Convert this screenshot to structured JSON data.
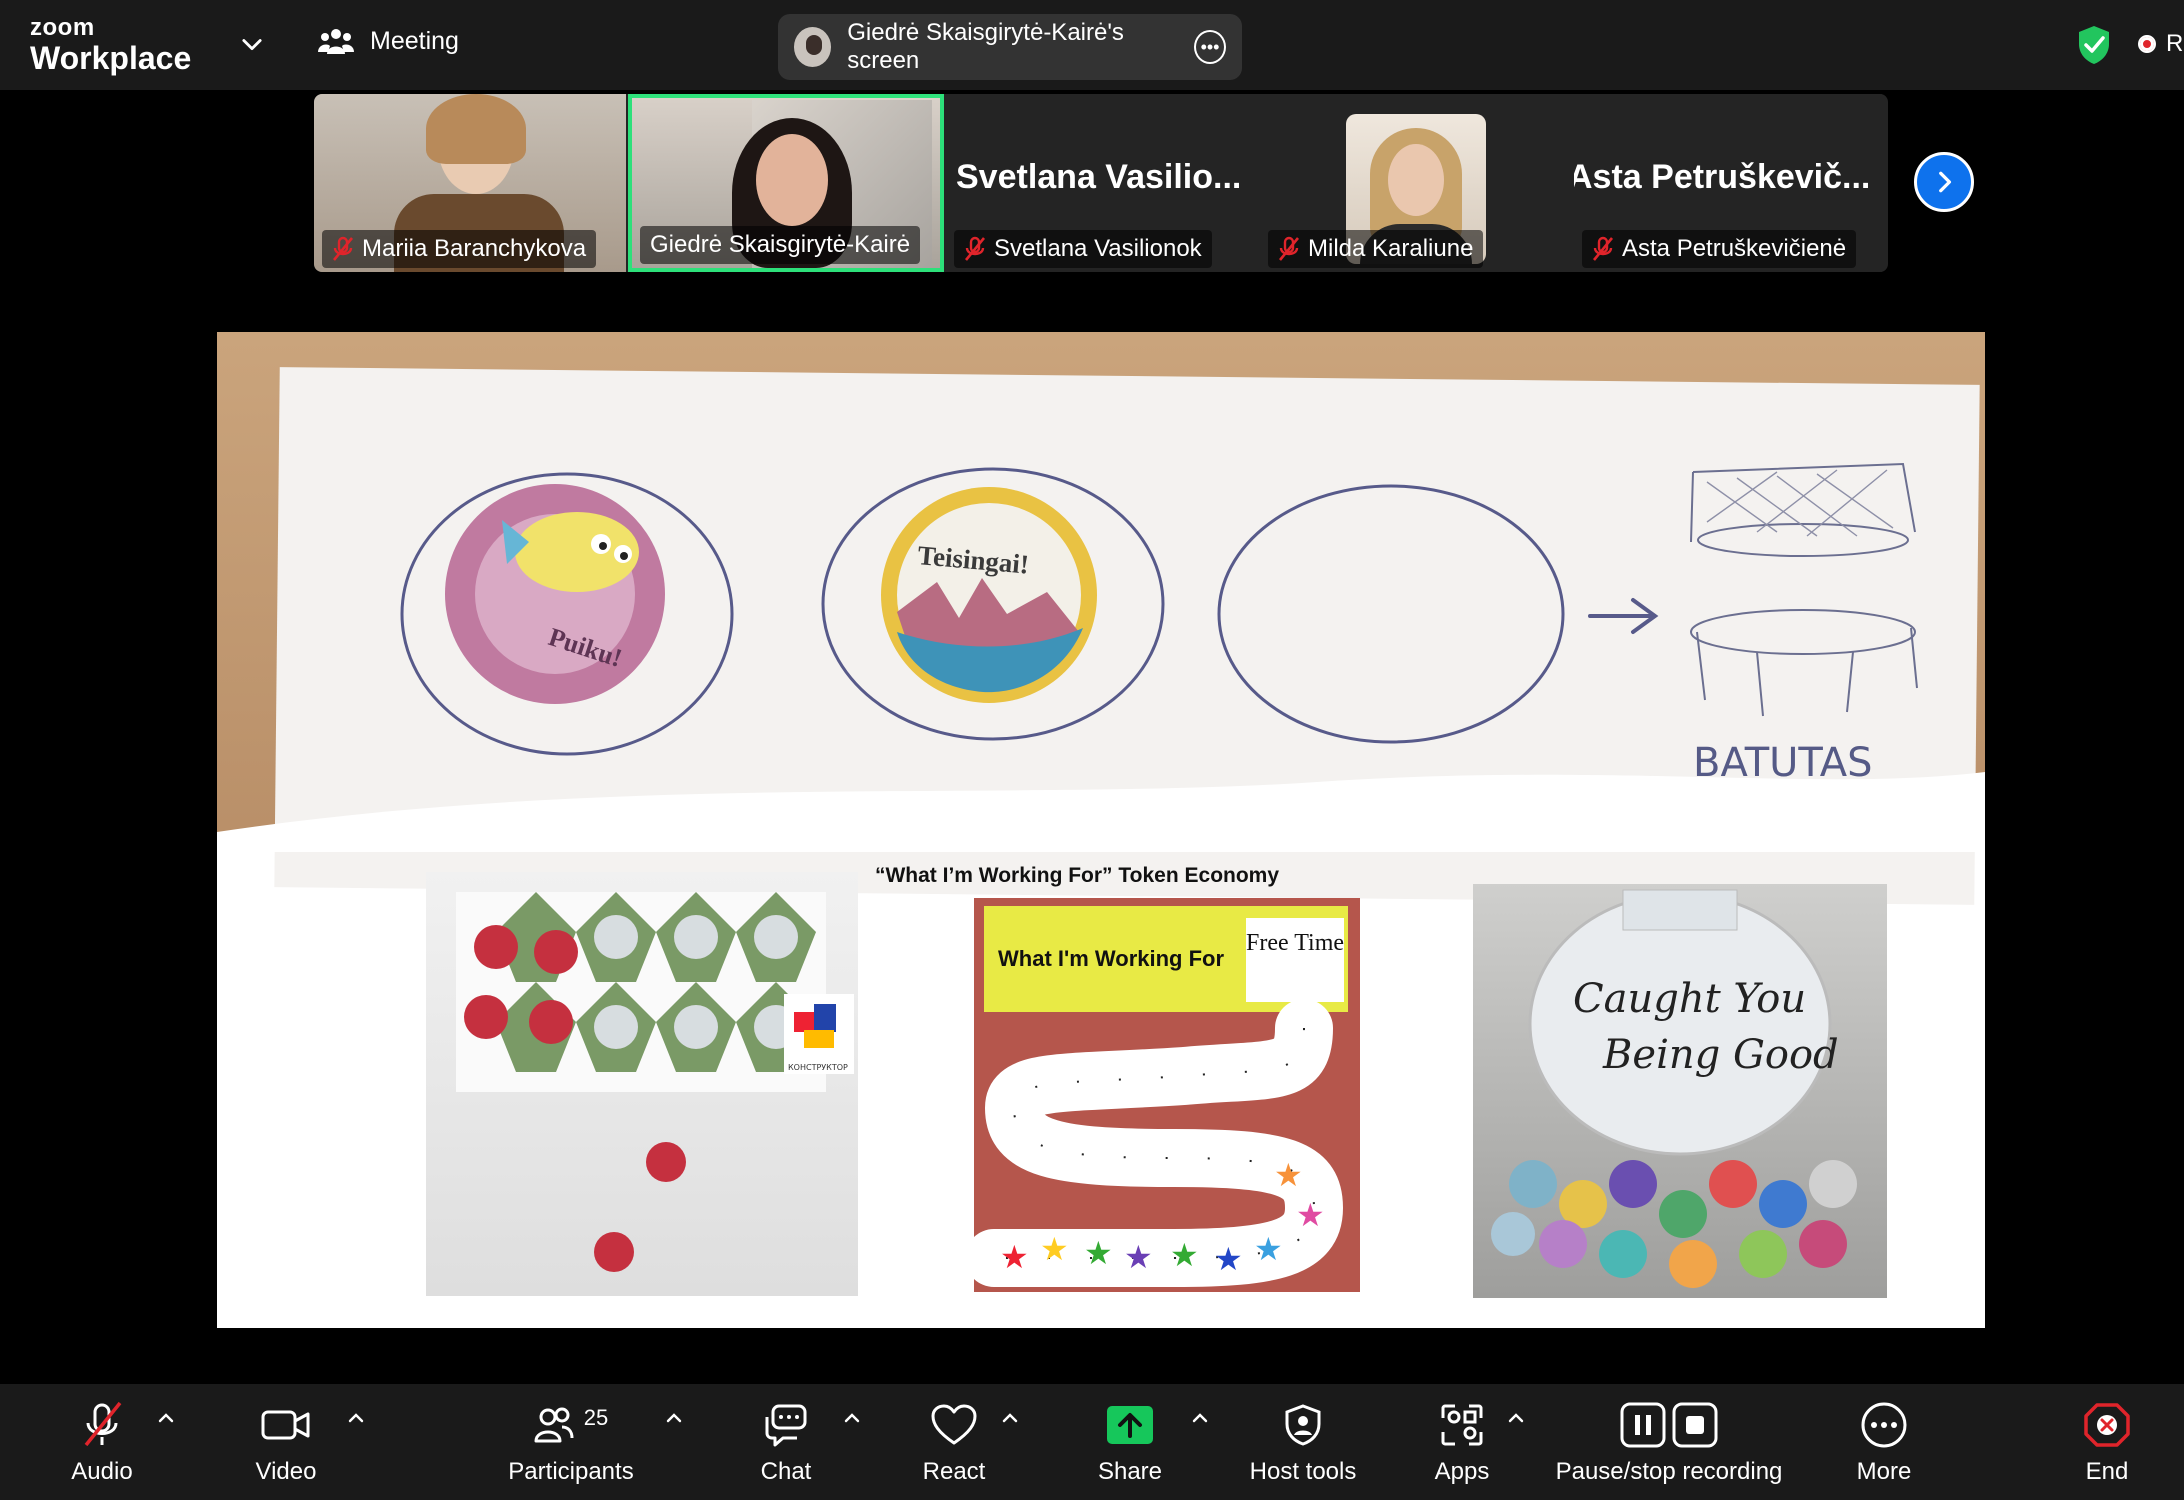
{
  "app": {
    "brand_small": "zoom",
    "brand_big": "Workplace"
  },
  "topbar": {
    "meeting_label": "Meeting",
    "screen_pill": "Giedrė Skaisgirytė-Kairė's screen",
    "recording_label": "R"
  },
  "participants_strip": {
    "tiles": [
      {
        "name": "Mariia Baranchykova",
        "muted": true,
        "video": true
      },
      {
        "name": "Giedrė Skaisgirytė-Kairė",
        "muted": false,
        "video": true,
        "active_speaker": true
      },
      {
        "name": "Svetlana Vasilionok",
        "display_big": "Svetlana  Vasilio...",
        "muted": true,
        "video": false
      },
      {
        "name": "Milda Karaliune",
        "muted": true,
        "video": false,
        "has_photo": true
      },
      {
        "name": "Asta Petruškevičienė",
        "display_big": "Asta  Petruškevič...",
        "muted": true,
        "video": false
      }
    ]
  },
  "shared_content": {
    "token_economy_caption": "“What I’m Working For” Token Economy",
    "token_board_title": "What I'm Working For",
    "token_board_reward": "Free Time",
    "sticker1_text": "Puiku!",
    "sticker2_text": "Teisingai!",
    "paper_label": "BATUTAS",
    "jar_text_line1": "Caught You",
    "jar_text_line2": "Being Good",
    "ladybug_card_text": "КОНСТРУКТОР"
  },
  "toolbar": {
    "audio": "Audio",
    "video": "Video",
    "participants": "Participants",
    "participants_count": "25",
    "chat": "Chat",
    "react": "React",
    "share": "Share",
    "host_tools": "Host tools",
    "apps": "Apps",
    "recording": "Pause/stop recording",
    "more": "More",
    "end": "End"
  },
  "colors": {
    "active_speaker_border": "#2de07a",
    "share_green": "#16c75b",
    "end_red": "#e0242b",
    "next_blue": "#0e72ed",
    "secure_green": "#22c55e"
  }
}
